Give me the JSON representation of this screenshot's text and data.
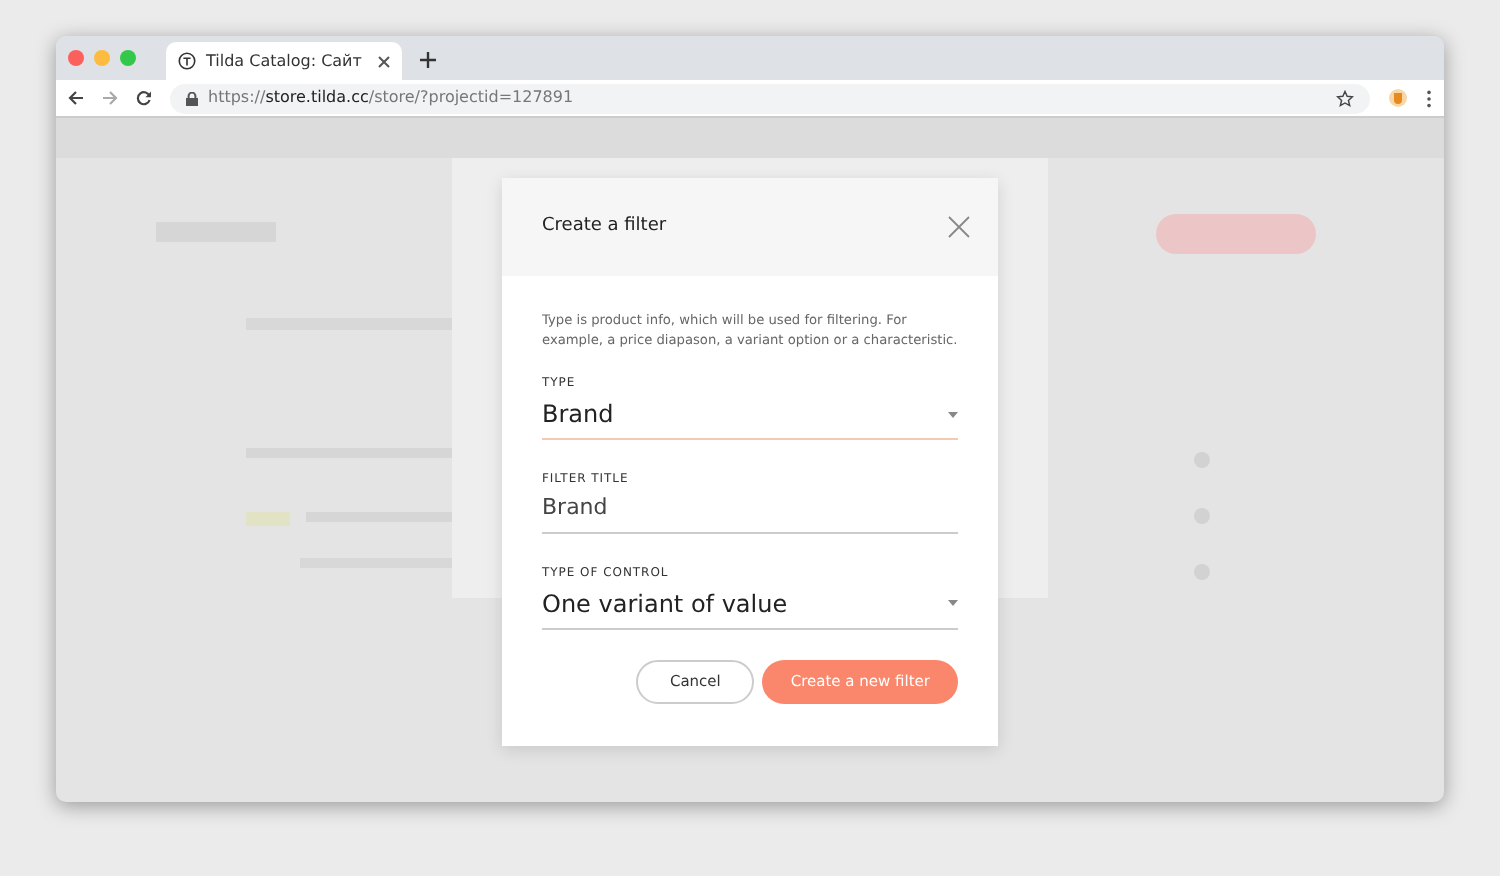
{
  "browser": {
    "tab_title": "Tilda Catalog: Сайт",
    "url": "https://**store.tilda.cc**/store/?projectid=127891"
  },
  "dialog": {
    "title": "Create a filter",
    "description": "Type is product info, which will be used for filtering. For example, a price diapason, a variant option or a characteristic.",
    "fields": [
      {
        "kind": "select",
        "label": "TYPE",
        "value": "Brand",
        "focused": true
      },
      {
        "kind": "text",
        "label": "FILTER TITLE",
        "value": "Brand",
        "focused": false
      },
      {
        "kind": "select",
        "label": "TYPE OF CONTROL",
        "value": "One variant of value",
        "focused": false
      }
    ],
    "buttons": [
      {
        "label": "Cancel",
        "kind": "secondary"
      },
      {
        "label": "Create a new filter",
        "kind": "primary"
      }
    ]
  }
}
